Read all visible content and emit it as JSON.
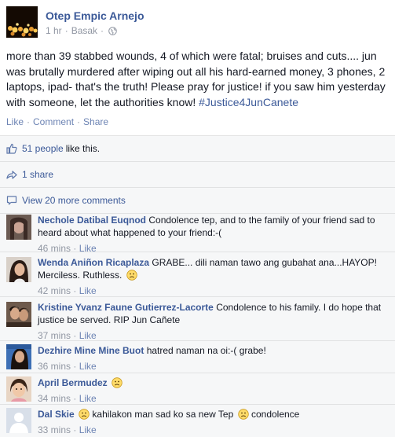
{
  "post": {
    "author": "Otep Empic Arnejo",
    "time": "1 hr",
    "location": "Basak",
    "globe_icon": "globe-icon",
    "text_main": "more than 39 stabbed wounds, 4 of which were fatal; bruises and cuts.... jun was brutally murdered after wiping out all his hard-earned money, 3 phones, 2 laptops, ipad- that's the truth! Please pray for justice! if you saw him yesterday with someone, let the authorities know!",
    "hashtag": "#Justice4JunCanete",
    "actions": {
      "like": "Like",
      "comment": "Comment",
      "share": "Share"
    }
  },
  "ufi": {
    "likes_link": "51 people",
    "likes_suffix": "like this.",
    "shares_link": "1 share",
    "more_comments_link": "View 20 more comments"
  },
  "comments": [
    {
      "name": "Nechole Datibal Euqnod",
      "text": "Condolence tep, and to the family of your friend sad to heard about what happened to your friend:-(",
      "time": "46 mins",
      "like": "Like",
      "smiley": false
    },
    {
      "name": "Wenda Aniñon Ricaplaza",
      "text": "GRABE... dili naman tawo ang gubahat ana...HAYOP! Merciless. Ruthless.",
      "time": "42 mins",
      "like": "Like",
      "smiley": true
    },
    {
      "name": "Kristine Yvanz Faune Gutierrez-Lacorte",
      "text": "Condolence to his family. I do hope that justice be served. RIP Jun Cañete",
      "time": "37 mins",
      "like": "Like",
      "smiley": false
    },
    {
      "name": "Dezhire Mine Mine Buot",
      "text": "hatred naman na oi:-( grabe!",
      "time": "36 mins",
      "like": "Like",
      "smiley": false
    },
    {
      "name": "April Bermudez",
      "text": "",
      "time": "34 mins",
      "like": "Like",
      "smiley": true
    },
    {
      "name": "Dal Skie",
      "text": "kahilakon man sad ko sa new Tep",
      "text2": "condolence",
      "time": "33 mins",
      "like": "Like",
      "smiley": true
    }
  ],
  "colors": {
    "link": "#3b5998",
    "muted": "#9197a3",
    "ufi_bg": "#f6f7f8"
  }
}
